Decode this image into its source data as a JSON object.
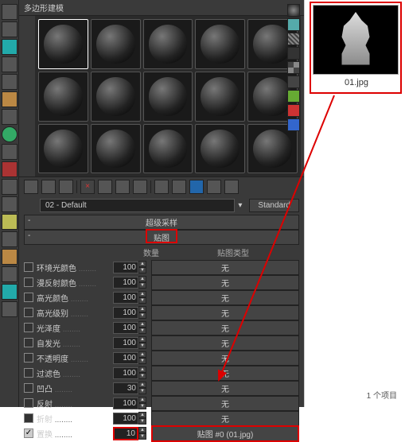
{
  "tab": {
    "label": "多边形建模"
  },
  "toolbar": {
    "x_icon": "×"
  },
  "material": {
    "name": "02 - Default",
    "type_label": "Standard"
  },
  "rollouts": {
    "supersampling": "超级采样",
    "maps": "贴图"
  },
  "columns": {
    "amount": "数量",
    "map_type": "贴图类型"
  },
  "maps": [
    {
      "label": "环境光颜色",
      "amount": "100",
      "map": "无",
      "checked": false
    },
    {
      "label": "漫反射颜色",
      "amount": "100",
      "map": "无",
      "checked": false
    },
    {
      "label": "高光颜色",
      "amount": "100",
      "map": "无",
      "checked": false
    },
    {
      "label": "高光级别",
      "amount": "100",
      "map": "无",
      "checked": false
    },
    {
      "label": "光泽度",
      "amount": "100",
      "map": "无",
      "checked": false
    },
    {
      "label": "自发光",
      "amount": "100",
      "map": "无",
      "checked": false
    },
    {
      "label": "不透明度",
      "amount": "100",
      "map": "无",
      "checked": false
    },
    {
      "label": "过滤色",
      "amount": "100",
      "map": "无",
      "checked": false
    },
    {
      "label": "凹凸",
      "amount": "30",
      "map": "无",
      "checked": false
    },
    {
      "label": "反射",
      "amount": "100",
      "map": "无",
      "checked": false
    },
    {
      "label": "折射",
      "amount": "100",
      "map": "无",
      "checked": false
    },
    {
      "label": "置换",
      "amount": "10",
      "map": "贴图 #0 (01.jpg)",
      "checked": true
    }
  ],
  "explorer": {
    "file_name": "01.jpg",
    "status": "1 个项目"
  },
  "swatches": [
    "#333",
    "#000",
    "#fff",
    "#888",
    "#6a3",
    "#c33",
    "#36c"
  ]
}
